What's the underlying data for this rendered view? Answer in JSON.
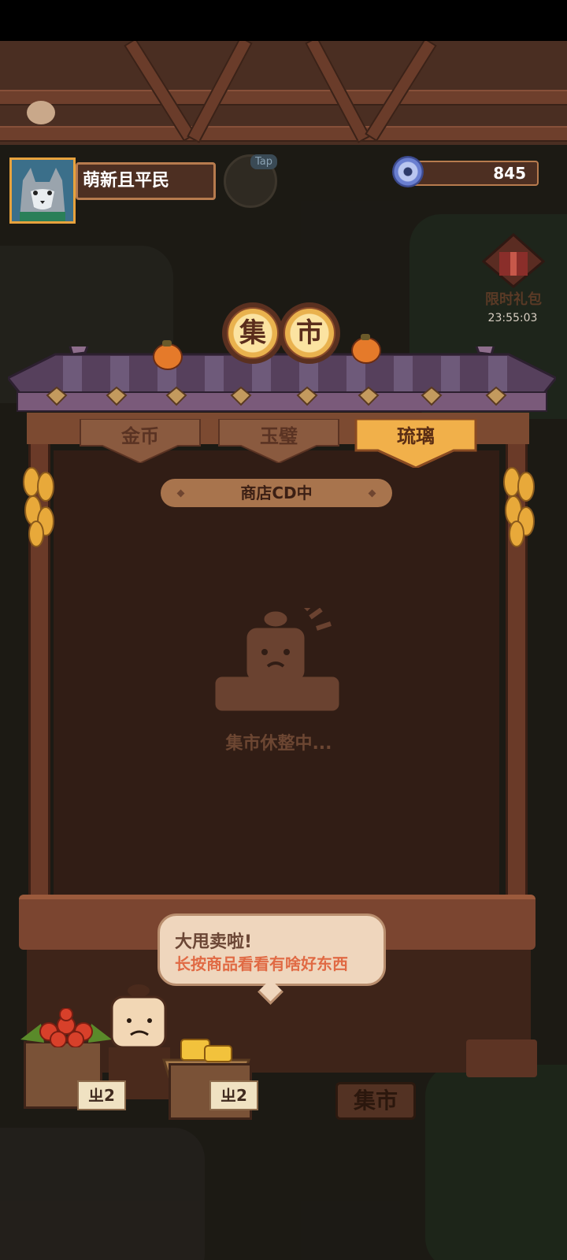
{
  "player": {
    "name": "萌新且平民"
  },
  "hud": {
    "tap_label": "Tap",
    "currency_amount": "845"
  },
  "gift": {
    "label": "限时礼包",
    "timer": "23:55:03"
  },
  "stall": {
    "title_chars": [
      "集",
      "市"
    ],
    "tabs": [
      {
        "label": "金币",
        "selected": false
      },
      {
        "label": "玉璧",
        "selected": false
      },
      {
        "label": "琉璃",
        "selected": true
      }
    ],
    "status_pill": "商店CD中",
    "empty_text": "集市休整中..."
  },
  "vendor_bubble": {
    "title": "大甩卖啦!",
    "subtitle": "长按商品看看有啥好东西"
  },
  "price_tags": [
    "ㄓ2",
    "ㄓ2"
  ],
  "market_button": "集市",
  "colors": {
    "selected_tab": "#f1b04a",
    "unselected_tab": "#8a5a3f",
    "panel": "#311d15",
    "bubble_subtitle": "#e06a44"
  }
}
